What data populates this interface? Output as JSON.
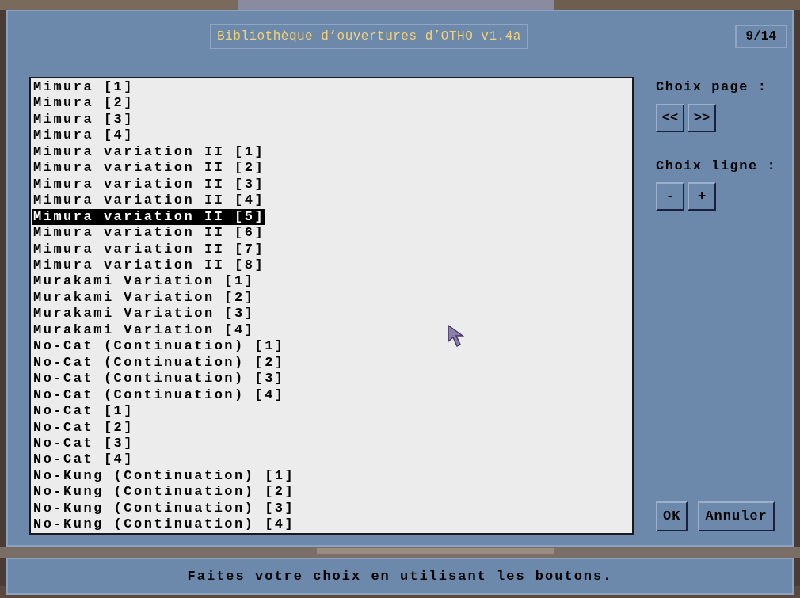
{
  "dialog": {
    "title": "Bibliothèque d’ouvertures d’OTHO v1.4a",
    "page_counter": "9/14"
  },
  "list": [
    {
      "label": "Mimura [1]",
      "selected": false
    },
    {
      "label": "Mimura [2]",
      "selected": false
    },
    {
      "label": "Mimura [3]",
      "selected": false
    },
    {
      "label": "Mimura [4]",
      "selected": false
    },
    {
      "label": "Mimura variation II [1]",
      "selected": false
    },
    {
      "label": "Mimura variation II [2]",
      "selected": false
    },
    {
      "label": "Mimura variation II [3]",
      "selected": false
    },
    {
      "label": "Mimura variation II [4]",
      "selected": false
    },
    {
      "label": "Mimura variation II [5]",
      "selected": true
    },
    {
      "label": "Mimura variation II [6]",
      "selected": false
    },
    {
      "label": "Mimura variation II [7]",
      "selected": false
    },
    {
      "label": "Mimura variation II [8]",
      "selected": false
    },
    {
      "label": "Murakami Variation [1]",
      "selected": false
    },
    {
      "label": "Murakami Variation [2]",
      "selected": false
    },
    {
      "label": "Murakami Variation [3]",
      "selected": false
    },
    {
      "label": "Murakami Variation [4]",
      "selected": false
    },
    {
      "label": "No-Cat (Continuation) [1]",
      "selected": false
    },
    {
      "label": "No-Cat (Continuation) [2]",
      "selected": false
    },
    {
      "label": "No-Cat (Continuation) [3]",
      "selected": false
    },
    {
      "label": "No-Cat (Continuation) [4]",
      "selected": false
    },
    {
      "label": "No-Cat [1]",
      "selected": false
    },
    {
      "label": "No-Cat [2]",
      "selected": false
    },
    {
      "label": "No-Cat [3]",
      "selected": false
    },
    {
      "label": "No-Cat [4]",
      "selected": false
    },
    {
      "label": "No-Kung (Continuation) [1]",
      "selected": false
    },
    {
      "label": "No-Kung (Continuation) [2]",
      "selected": false
    },
    {
      "label": "No-Kung (Continuation) [3]",
      "selected": false
    },
    {
      "label": "No-Kung (Continuation) [4]",
      "selected": false
    }
  ],
  "page_choice": {
    "label": "Choix page :",
    "buttons": [
      "<<",
      ">>"
    ]
  },
  "line_choice": {
    "label": "Choix ligne :",
    "buttons": [
      "-",
      "+"
    ]
  },
  "actions": [
    "OK",
    "Annuler"
  ],
  "status_bar": "Faites votre choix en utilisant les boutons."
}
